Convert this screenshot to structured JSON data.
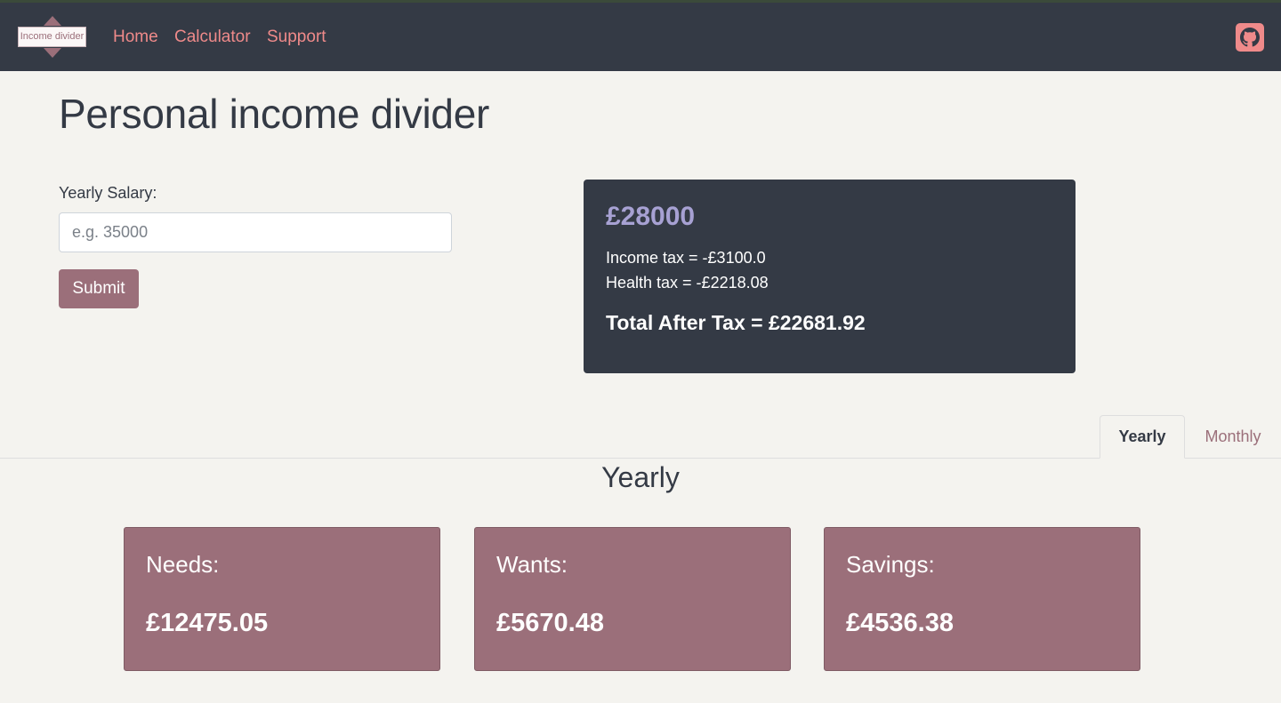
{
  "navbar": {
    "logo_text": "Income divider",
    "links": [
      {
        "label": "Home"
      },
      {
        "label": "Calculator"
      },
      {
        "label": "Support"
      }
    ],
    "github_icon": "github-icon",
    "accent_color": "#ef8a8a",
    "background_color": "#343a45"
  },
  "main": {
    "title": "Personal income divider",
    "form": {
      "salary_label": "Yearly Salary:",
      "salary_value": "",
      "salary_placeholder": "e.g. 35000",
      "submit_label": "Submit"
    },
    "result": {
      "gross": "£28000",
      "income_tax": "Income tax = -£3100.0",
      "health_tax": "Health tax = -£2218.08",
      "total_after_tax": "Total After Tax = £22681.92"
    },
    "tabs": [
      {
        "label": "Yearly",
        "active": true
      },
      {
        "label": "Monthly",
        "active": false
      }
    ],
    "section_title": "Yearly",
    "buckets": [
      {
        "label": "Needs:",
        "value": "£12475.05"
      },
      {
        "label": "Wants:",
        "value": "£5670.48"
      },
      {
        "label": "Savings:",
        "value": "£4536.38"
      }
    ],
    "bucket_color": "#9b6f7a",
    "gross_color": "#a7a1d3"
  }
}
